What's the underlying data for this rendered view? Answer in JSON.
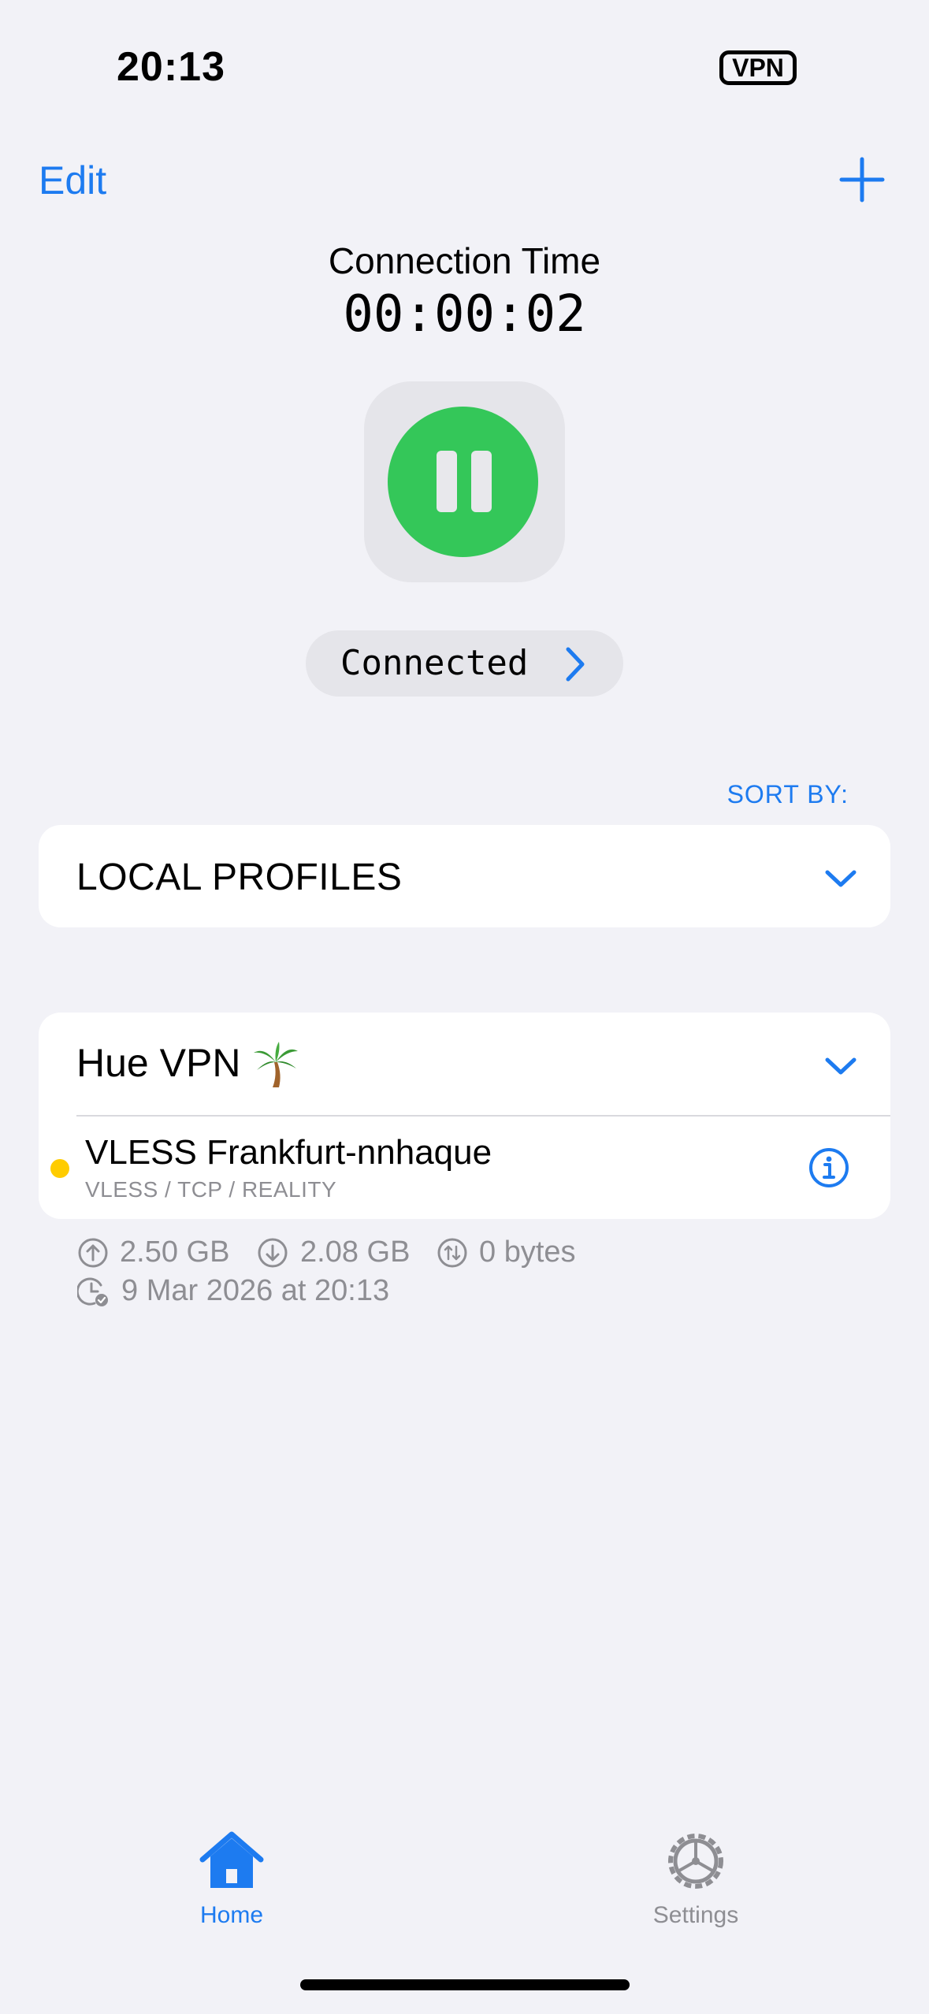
{
  "status_bar": {
    "time": "20:13",
    "vpn_badge": "VPN"
  },
  "nav": {
    "edit_label": "Edit",
    "add_icon": "plus-icon"
  },
  "connection": {
    "label": "Connection Time",
    "elapsed": "00:00:02",
    "toggle_icon": "pause-icon",
    "status": "Connected"
  },
  "sort": {
    "label": "SORT BY:"
  },
  "local_profiles": {
    "title": "LOCAL PROFILES"
  },
  "subscription_group": {
    "title": "Hue VPN",
    "emoji": "🌴",
    "profiles": [
      {
        "name": "VLESS Frankfurt-nnhaque",
        "subtitle": "VLESS / TCP / REALITY",
        "status_color": "#ffcc00"
      }
    ]
  },
  "stats": {
    "upload": "2.50 GB",
    "download": "2.08 GB",
    "total": "0 bytes",
    "last_updated": "9 Mar 2026 at 20:13"
  },
  "tab_bar": {
    "tabs": [
      {
        "label": "Home",
        "icon": "house-icon",
        "active": true
      },
      {
        "label": "Settings",
        "icon": "gear-icon",
        "active": false
      }
    ]
  },
  "colors": {
    "accent": "#1d7bf0",
    "connected": "#34c759",
    "background": "#f2f2f7",
    "secondary_text": "#8e8e93"
  }
}
